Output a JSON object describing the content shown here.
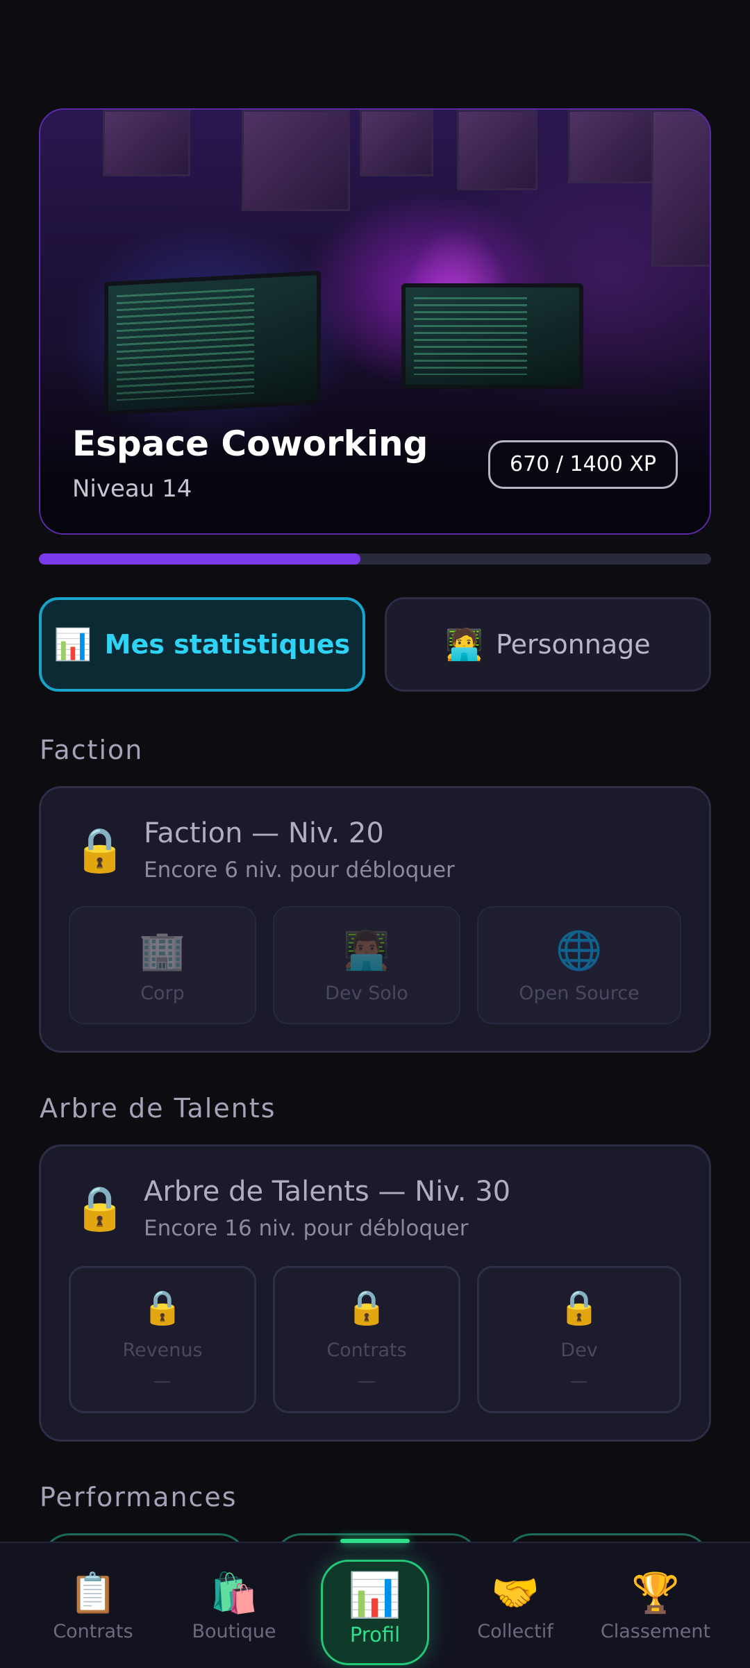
{
  "hero": {
    "title": "Espace Coworking",
    "subtitle": "Niveau 14",
    "xp": "670 / 1400 XP",
    "xp_progress": 0.478
  },
  "tabs": [
    {
      "icon": "📊",
      "icon_name": "bar-chart-icon",
      "label": "Mes statistiques",
      "active": true
    },
    {
      "icon": "🧑‍💻",
      "icon_name": "technologist-icon",
      "label": "Personnage",
      "active": false
    }
  ],
  "faction": {
    "section_title": "Faction",
    "lock_icon": "🔒",
    "title": "Faction — Niv. 20",
    "subtitle": "Encore 6 niv. pour débloquer",
    "options": [
      {
        "icon": "🏢",
        "icon_name": "office-building-icon",
        "label": "Corp"
      },
      {
        "icon": "👨🏾‍💻",
        "icon_name": "developer-icon",
        "label": "Dev Solo"
      },
      {
        "icon": "🌐",
        "icon_name": "globe-icon",
        "label": "Open Source"
      }
    ]
  },
  "talents": {
    "section_title": "Arbre de Talents",
    "lock_icon": "🔒",
    "title": "Arbre de Talents — Niv. 30",
    "subtitle": "Encore 16 niv. pour débloquer",
    "branches": [
      {
        "icon": "🔒",
        "label": "Revenus",
        "value": "—"
      },
      {
        "icon": "🔒",
        "label": "Contrats",
        "value": "—"
      },
      {
        "icon": "🔒",
        "label": "Dev",
        "value": "—"
      }
    ]
  },
  "performances": {
    "section_title": "Performances"
  },
  "nav": {
    "items": [
      {
        "icon": "📋",
        "icon_name": "clipboard-icon",
        "label": "Contrats"
      },
      {
        "icon": "🛍️",
        "icon_name": "shopping-bags-icon",
        "label": "Boutique"
      },
      {
        "icon": "📊",
        "icon_name": "bar-chart-icon",
        "label": "Profil",
        "active": true
      },
      {
        "icon": "🤝",
        "icon_name": "handshake-icon",
        "label": "Collectif"
      },
      {
        "icon": "🏆",
        "icon_name": "trophy-icon",
        "label": "Classement"
      }
    ]
  },
  "colors": {
    "accent_purple": "#7c3aed",
    "accent_cyan": "#2fd3f5",
    "accent_green": "#2fe08a",
    "background": "#0c0c11"
  }
}
